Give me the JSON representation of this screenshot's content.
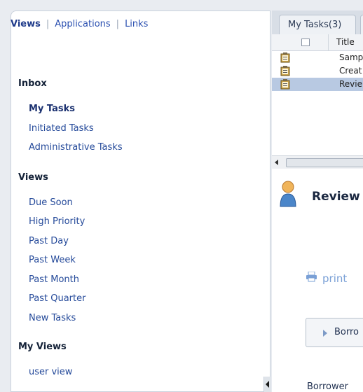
{
  "header": {
    "views": "Views",
    "applications": "Applications",
    "links": "Links"
  },
  "inbox": {
    "title": "Inbox",
    "items": [
      "My Tasks",
      "Initiated Tasks",
      "Administrative Tasks"
    ]
  },
  "views": {
    "title": "Views",
    "items": [
      "Due Soon",
      "High Priority",
      "Past Day",
      "Past Week",
      "Past Month",
      "Past Quarter",
      "New Tasks"
    ]
  },
  "my_views": {
    "title": "My Views",
    "items": [
      "user view"
    ]
  },
  "tasks_tab": {
    "label": "My Tasks(3)"
  },
  "grid": {
    "title_header": "Title",
    "rows": [
      "Samp",
      "Creat",
      "Revie"
    ]
  },
  "detail": {
    "title": "Review",
    "print_label": "print",
    "section_label": "Borro",
    "field_label": "Borrower"
  },
  "colors": {
    "link": "#254a9a",
    "selected_row": "#b8c9e2"
  }
}
